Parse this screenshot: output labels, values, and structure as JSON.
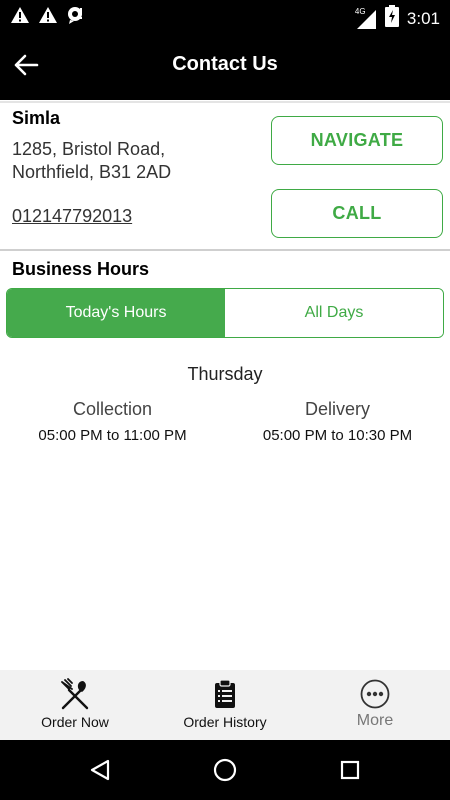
{
  "status_bar": {
    "time": "3:01",
    "network": "4G",
    "icons": [
      "warning-icon",
      "warning-icon",
      "notification-icon",
      "signal-icon",
      "battery-charging-icon"
    ]
  },
  "app_bar": {
    "title": "Contact Us",
    "back_icon": "arrow-left-icon"
  },
  "store": {
    "name": "Simla",
    "address_line1": "1285, Bristol Road,",
    "address_line2": "Northfield, B31 2AD",
    "phone": "012147792013"
  },
  "actions": {
    "navigate_label": "NAVIGATE",
    "call_label": "CALL"
  },
  "hours": {
    "heading": "Business Hours",
    "tabs": [
      {
        "label": "Today's Hours",
        "selected": true
      },
      {
        "label": "All Days",
        "selected": false
      }
    ],
    "day": "Thursday",
    "collection": {
      "title": "Collection",
      "time": "05:00 PM to 11:00 PM"
    },
    "delivery": {
      "title": "Delivery",
      "time": "05:00 PM to 10:30 PM"
    }
  },
  "bottom_nav": {
    "items": [
      {
        "label": "Order Now",
        "icon": "fork-knife-icon"
      },
      {
        "label": "Order History",
        "icon": "clipboard-list-icon"
      },
      {
        "label": "More",
        "icon": "more-dots-icon"
      }
    ]
  },
  "system_nav": {
    "icons": [
      "back-triangle-icon",
      "home-circle-icon",
      "recents-square-icon"
    ]
  },
  "colors": {
    "accent": "#3faa45",
    "app_bar": "#000000",
    "bottom_nav_bg": "#f2f2f2"
  }
}
